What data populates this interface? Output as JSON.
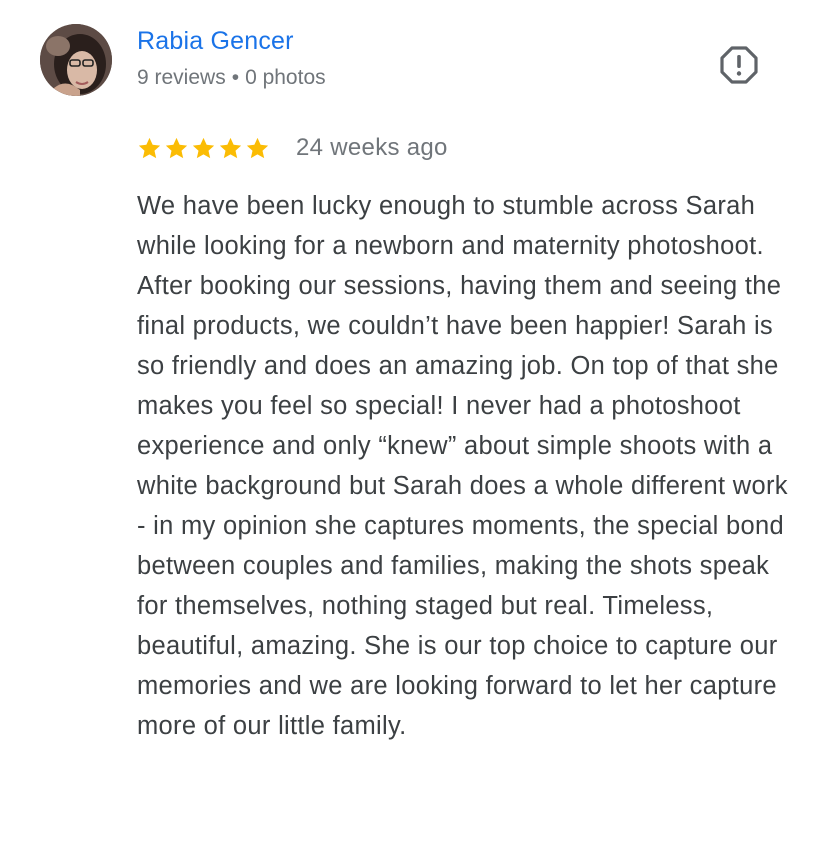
{
  "reviewer": {
    "name": "Rabia Gencer",
    "reviews_count": "9 reviews",
    "separator": "•",
    "photos_count": "0 photos",
    "avatar_icon": "profile-photo"
  },
  "report": {
    "icon": "report-flag-icon"
  },
  "rating": {
    "stars": 5,
    "max_stars": 5,
    "star_color": "#fbbc04",
    "time": "24 weeks ago"
  },
  "review": {
    "text": "We have been lucky enough to stumble across Sarah while looking for a newborn and maternity photoshoot. After booking our sessions, having them and seeing the final products, we couldn’t have been happier! Sarah is so friendly and does an amazing job. On top of that she makes you feel so special! I never had a photoshoot experience and only “knew” about simple shoots with a white background but Sarah does a whole different work - in my opinion she captures moments, the special bond between couples and families, making the shots speak for themselves, nothing staged but real. Timeless, beautiful, amazing. She is our top choice to capture our memories and we are looking forward to let her capture more of our little family."
  },
  "colors": {
    "name": "#1a73e8",
    "meta": "#70757a",
    "body_text": "#3c4043",
    "icon": "#5f6368"
  }
}
